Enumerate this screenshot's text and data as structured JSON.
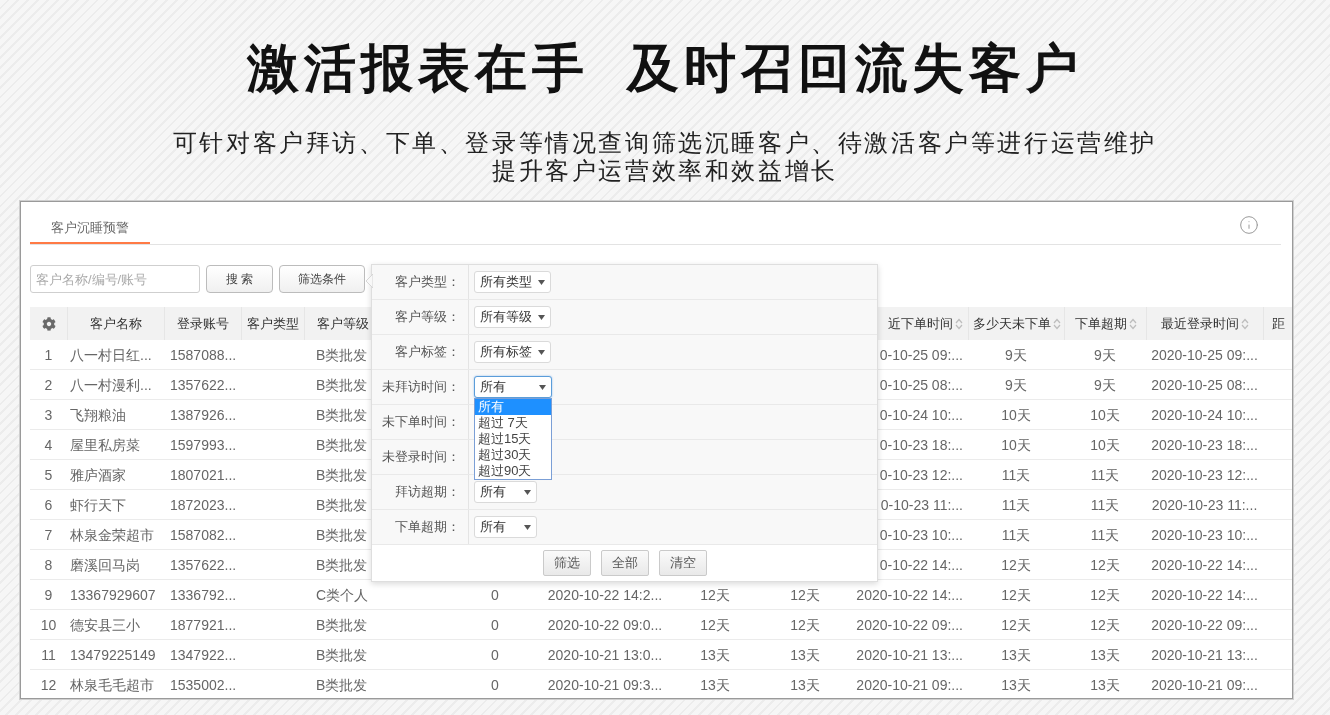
{
  "headline": "激活报表在手  及时召回流失客户",
  "subtitle_lines": [
    "可针对客户拜访、下单、登录等情况查询筛选沉睡客户、待激活客户等进行运营维护",
    "提升客户运营效率和效益增长"
  ],
  "panel": {
    "tabs": [
      {
        "label": "客户沉睡预警",
        "selected": true
      }
    ],
    "search": {
      "placeholder": "客户名称/编号/账号",
      "button": "搜 索"
    },
    "filter_button": "筛选条件",
    "table": {
      "columns": [
        {
          "kind": "settings"
        },
        {
          "kind": "text",
          "label": "客户名称",
          "sortable": false
        },
        {
          "kind": "text",
          "label": "登录账号",
          "sortable": false
        },
        {
          "kind": "text",
          "label": "客户类型",
          "sortable": false
        },
        {
          "kind": "text",
          "label": "客户等级",
          "sortable": false
        },
        {
          "kind": "covered"
        },
        {
          "kind": "covered"
        },
        {
          "kind": "covered"
        },
        {
          "kind": "covered"
        },
        {
          "kind": "covered"
        },
        {
          "kind": "text",
          "label": "近下单时间",
          "sortable": true
        },
        {
          "kind": "text",
          "label": "多少天未下单",
          "sortable": true
        },
        {
          "kind": "text",
          "label": "下单超期",
          "sortable": true
        },
        {
          "kind": "text",
          "label": "最近登录时间",
          "sortable": true
        },
        {
          "kind": "text",
          "label": "距",
          "sortable": false
        }
      ],
      "rows": [
        {
          "cells": [
            "1",
            "八一村日红...",
            "1587088...",
            null,
            "B类批发",
            null,
            null,
            null,
            null,
            null,
            "0-10-25 09:...",
            "9天",
            "9天",
            "2020-10-25 09:...",
            null
          ]
        },
        {
          "cells": [
            "2",
            "八一村漫利...",
            "1357622...",
            null,
            "B类批发",
            null,
            null,
            null,
            null,
            null,
            "0-10-25 08:...",
            "9天",
            "9天",
            "2020-10-25 08:...",
            null
          ]
        },
        {
          "cells": [
            "3",
            "飞翔粮油",
            "1387926...",
            null,
            "B类批发",
            null,
            null,
            null,
            null,
            null,
            "0-10-24 10:...",
            "10天",
            "10天",
            "2020-10-24 10:...",
            null
          ]
        },
        {
          "cells": [
            "4",
            "屋里私房菜",
            "1597993...",
            null,
            "B类批发",
            null,
            null,
            null,
            null,
            null,
            "0-10-23 18:...",
            "10天",
            "10天",
            "2020-10-23 18:...",
            null
          ]
        },
        {
          "cells": [
            "5",
            "雅庐酒家",
            "1807021...",
            null,
            "B类批发",
            null,
            null,
            null,
            null,
            null,
            "0-10-23 12:...",
            "11天",
            "11天",
            "2020-10-23 12:...",
            null
          ]
        },
        {
          "cells": [
            "6",
            "虾行天下",
            "1872023...",
            null,
            "B类批发",
            null,
            null,
            null,
            null,
            null,
            "0-10-23 11:...",
            "11天",
            "11天",
            "2020-10-23 11:...",
            null
          ]
        },
        {
          "cells": [
            "7",
            "林泉金荣超市",
            "1587082...",
            null,
            "B类批发",
            null,
            null,
            null,
            null,
            null,
            "0-10-23 10:...",
            "11天",
            "11天",
            "2020-10-23 10:...",
            null
          ]
        },
        {
          "cells": [
            "8",
            "磨溪回马岗",
            "1357622...",
            null,
            "B类批发",
            null,
            null,
            null,
            null,
            null,
            "0-10-22 14:...",
            "12天",
            "12天",
            "2020-10-22 14:...",
            null
          ]
        },
        {
          "cells": [
            "9",
            "13367929607",
            "1336792...",
            null,
            "C类个人",
            null,
            "0",
            "2020-10-22 14:2...",
            "12天",
            "12天",
            "2020-10-22 14:...",
            "12天",
            "12天",
            "2020-10-22 14:...",
            null
          ]
        },
        {
          "cells": [
            "10",
            "德安县三小",
            "1877921...",
            null,
            "B类批发",
            null,
            "0",
            "2020-10-22 09:0...",
            "12天",
            "12天",
            "2020-10-22 09:...",
            "12天",
            "12天",
            "2020-10-22 09:...",
            null
          ]
        },
        {
          "cells": [
            "11",
            "13479225149",
            "1347922...",
            null,
            "B类批发",
            null,
            "0",
            "2020-10-21 13:0...",
            "13天",
            "13天",
            "2020-10-21 13:...",
            "13天",
            "13天",
            "2020-10-21 13:...",
            null
          ]
        },
        {
          "cells": [
            "12",
            "林泉毛毛超市",
            "1535002...",
            null,
            "B类批发",
            null,
            "0",
            "2020-10-21 09:3...",
            "13天",
            "13天",
            "2020-10-21 09:...",
            "13天",
            "13天",
            "2020-10-21 09:...",
            null
          ]
        }
      ]
    },
    "filter_popover": {
      "fields": [
        {
          "label": "客户类型：",
          "value": "所有类型",
          "open": false
        },
        {
          "label": "客户等级：",
          "value": "所有等级",
          "open": false
        },
        {
          "label": "客户标签：",
          "value": "所有标签",
          "open": false
        },
        {
          "label": "未拜访时间：",
          "value": "所有",
          "open": true,
          "options": [
            {
              "label": "所有",
              "selected": true
            },
            {
              "label": "超过 7天",
              "selected": false
            },
            {
              "label": "超过15天",
              "selected": false
            },
            {
              "label": "超过30天",
              "selected": false
            },
            {
              "label": "超过90天",
              "selected": false
            }
          ]
        },
        {
          "label": "未下单时间："
        },
        {
          "label": "未登录时间："
        },
        {
          "label": "拜访超期：",
          "value": "所有",
          "open": false
        },
        {
          "label": "下单超期：",
          "value": "所有",
          "open": false
        }
      ],
      "buttons": [
        "筛选",
        "全部",
        "清空"
      ]
    }
  }
}
